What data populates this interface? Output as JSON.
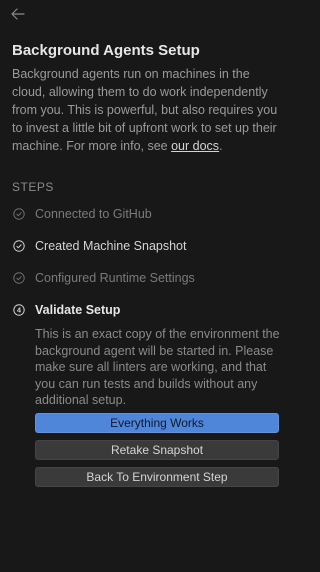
{
  "header": {
    "back_icon": "arrow-left-icon"
  },
  "page": {
    "title": "Background Agents Setup",
    "intro_text": "Background agents run on machines in the cloud, allowing them to do work independently from you. This is powerful, but also requires you to invest a little bit of upfront work to set up their machine. For more info, see ",
    "docs_link": "our docs",
    "intro_suffix": "."
  },
  "steps": {
    "label": "STEPS",
    "items": [
      {
        "label": "Connected to GitHub",
        "state": "done",
        "icon": "check-circle-icon"
      },
      {
        "label": "Created Machine Snapshot",
        "state": "done",
        "icon": "check-circle-icon"
      },
      {
        "label": "Configured Runtime Settings",
        "state": "done",
        "icon": "check-circle-icon"
      },
      {
        "label": "Validate Setup",
        "state": "active",
        "icon": "number-4-circle-icon",
        "number": "4"
      }
    ],
    "active_description": "This is an exact copy of the environment the background agent will be started in. Please make sure all linters are working, and that you can run tests and builds without any additional setup."
  },
  "actions": {
    "everything_works": "Everything Works",
    "retake_snapshot": "Retake Snapshot",
    "back_to_environment": "Back To Environment Step"
  },
  "colors": {
    "background": "#181818",
    "primary_button": "#4f86d9",
    "secondary_button": "#3a3a3a"
  }
}
